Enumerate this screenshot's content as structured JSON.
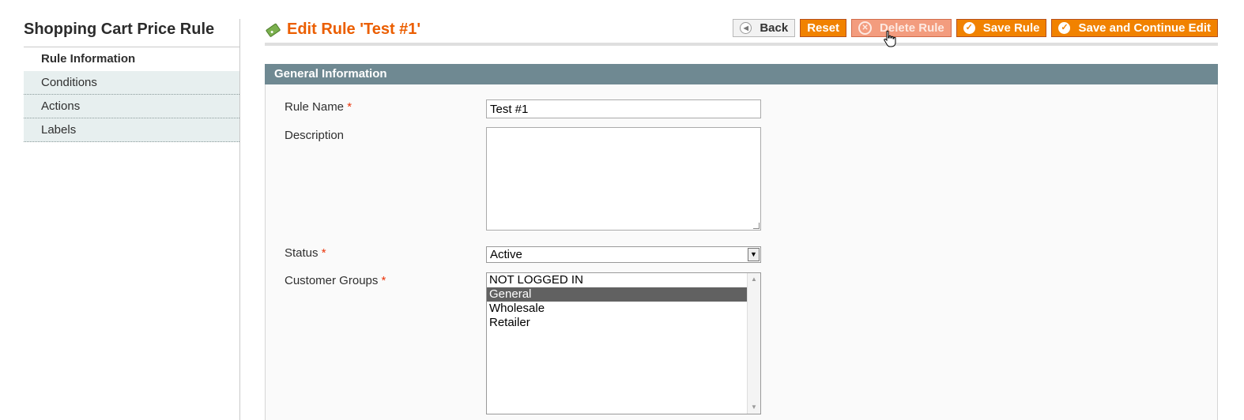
{
  "sidebar": {
    "title": "Shopping Cart Price Rule",
    "tabs": [
      {
        "label": "Rule Information",
        "active": true
      },
      {
        "label": "Conditions",
        "active": false
      },
      {
        "label": "Actions",
        "active": false
      },
      {
        "label": "Labels",
        "active": false
      }
    ]
  },
  "header": {
    "title": "Edit Rule 'Test #1'",
    "icon": "edit-rule-icon",
    "buttons": {
      "back": "Back",
      "reset": "Reset",
      "delete": "Delete Rule",
      "save": "Save Rule",
      "save_continue": "Save and Continue Edit"
    }
  },
  "section": {
    "title": "General Information",
    "fields": {
      "rule_name": {
        "label": "Rule Name",
        "value": "Test #1",
        "required": "*"
      },
      "description": {
        "label": "Description",
        "value": ""
      },
      "status": {
        "label": "Status",
        "value": "Active",
        "required": "*"
      },
      "customer_groups": {
        "label": "Customer Groups",
        "required": "*",
        "options": [
          "NOT LOGGED IN",
          "General",
          "Wholesale",
          "Retailer"
        ],
        "selected": "General"
      }
    }
  },
  "colors": {
    "accent": "#eb5e00",
    "button": "#f18200",
    "section_bar": "#6f8992",
    "tab_bg": "#e7efef"
  }
}
